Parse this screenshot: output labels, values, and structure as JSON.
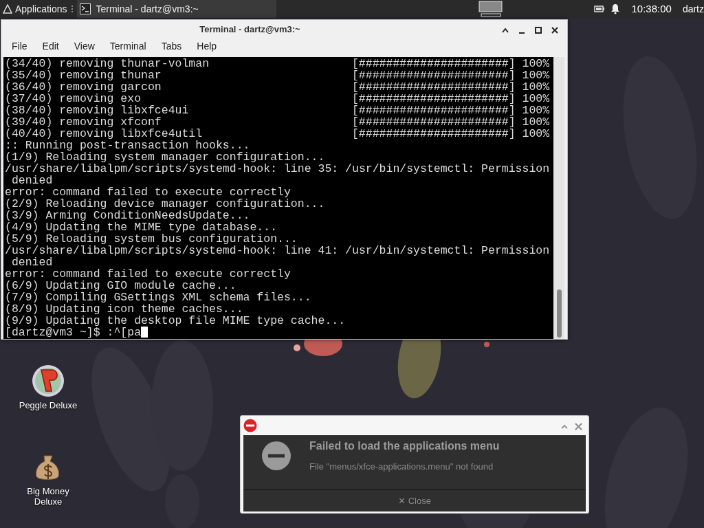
{
  "panel": {
    "apps_label": "Applications",
    "tasks": [
      {
        "label": "Terminal - dartz@vm3:~",
        "selected": true
      }
    ],
    "clock": "10:38:00",
    "user": "dartz"
  },
  "terminal": {
    "title": "Terminal - dartz@vm3:~",
    "menu": [
      "File",
      "Edit",
      "View",
      "Terminal",
      "Tabs",
      "Help"
    ],
    "lines": [
      {
        "text": "(34/40) removing thunar-volman",
        "progress": "[######################] 100%"
      },
      {
        "text": "(35/40) removing thunar",
        "progress": "[######################] 100%"
      },
      {
        "text": "(36/40) removing garcon",
        "progress": "[######################] 100%"
      },
      {
        "text": "(37/40) removing exo",
        "progress": "[######################] 100%"
      },
      {
        "text": "(38/40) removing libxfce4ui",
        "progress": "[######################] 100%"
      },
      {
        "text": "(39/40) removing xfconf",
        "progress": "[######################] 100%"
      },
      {
        "text": "(40/40) removing libxfce4util",
        "progress": "[######################] 100%"
      },
      {
        "text": ":: Running post-transaction hooks..."
      },
      {
        "text": "(1/9) Reloading system manager configuration..."
      },
      {
        "text": "/usr/share/libalpm/scripts/systemd-hook: line 35: /usr/bin/systemctl: Permission"
      },
      {
        "text": " denied"
      },
      {
        "text": "error: command failed to execute correctly"
      },
      {
        "text": "(2/9) Reloading device manager configuration..."
      },
      {
        "text": "(3/9) Arming ConditionNeedsUpdate..."
      },
      {
        "text": "(4/9) Updating the MIME type database..."
      },
      {
        "text": "(5/9) Reloading system bus configuration..."
      },
      {
        "text": "/usr/share/libalpm/scripts/systemd-hook: line 41: /usr/bin/systemctl: Permission"
      },
      {
        "text": " denied"
      },
      {
        "text": "error: command failed to execute correctly"
      },
      {
        "text": "(6/9) Updating GIO module cache..."
      },
      {
        "text": "(7/9) Compiling GSettings XML schema files..."
      },
      {
        "text": "(8/9) Updating icon theme caches..."
      },
      {
        "text": "(9/9) Updating the desktop file MIME type cache..."
      }
    ],
    "prompt": "[dartz@vm3 ~]$ :^[pa"
  },
  "desktop_icons": [
    {
      "kind": "peggle",
      "label": "Peggle Deluxe"
    },
    {
      "kind": "moneybag",
      "label": "Big Money Deluxe"
    }
  ],
  "notification": {
    "title": "Failed to load the applications menu",
    "message": "File \"menus/xfce-applications.menu\" not found",
    "close_label": "✕ Close"
  }
}
